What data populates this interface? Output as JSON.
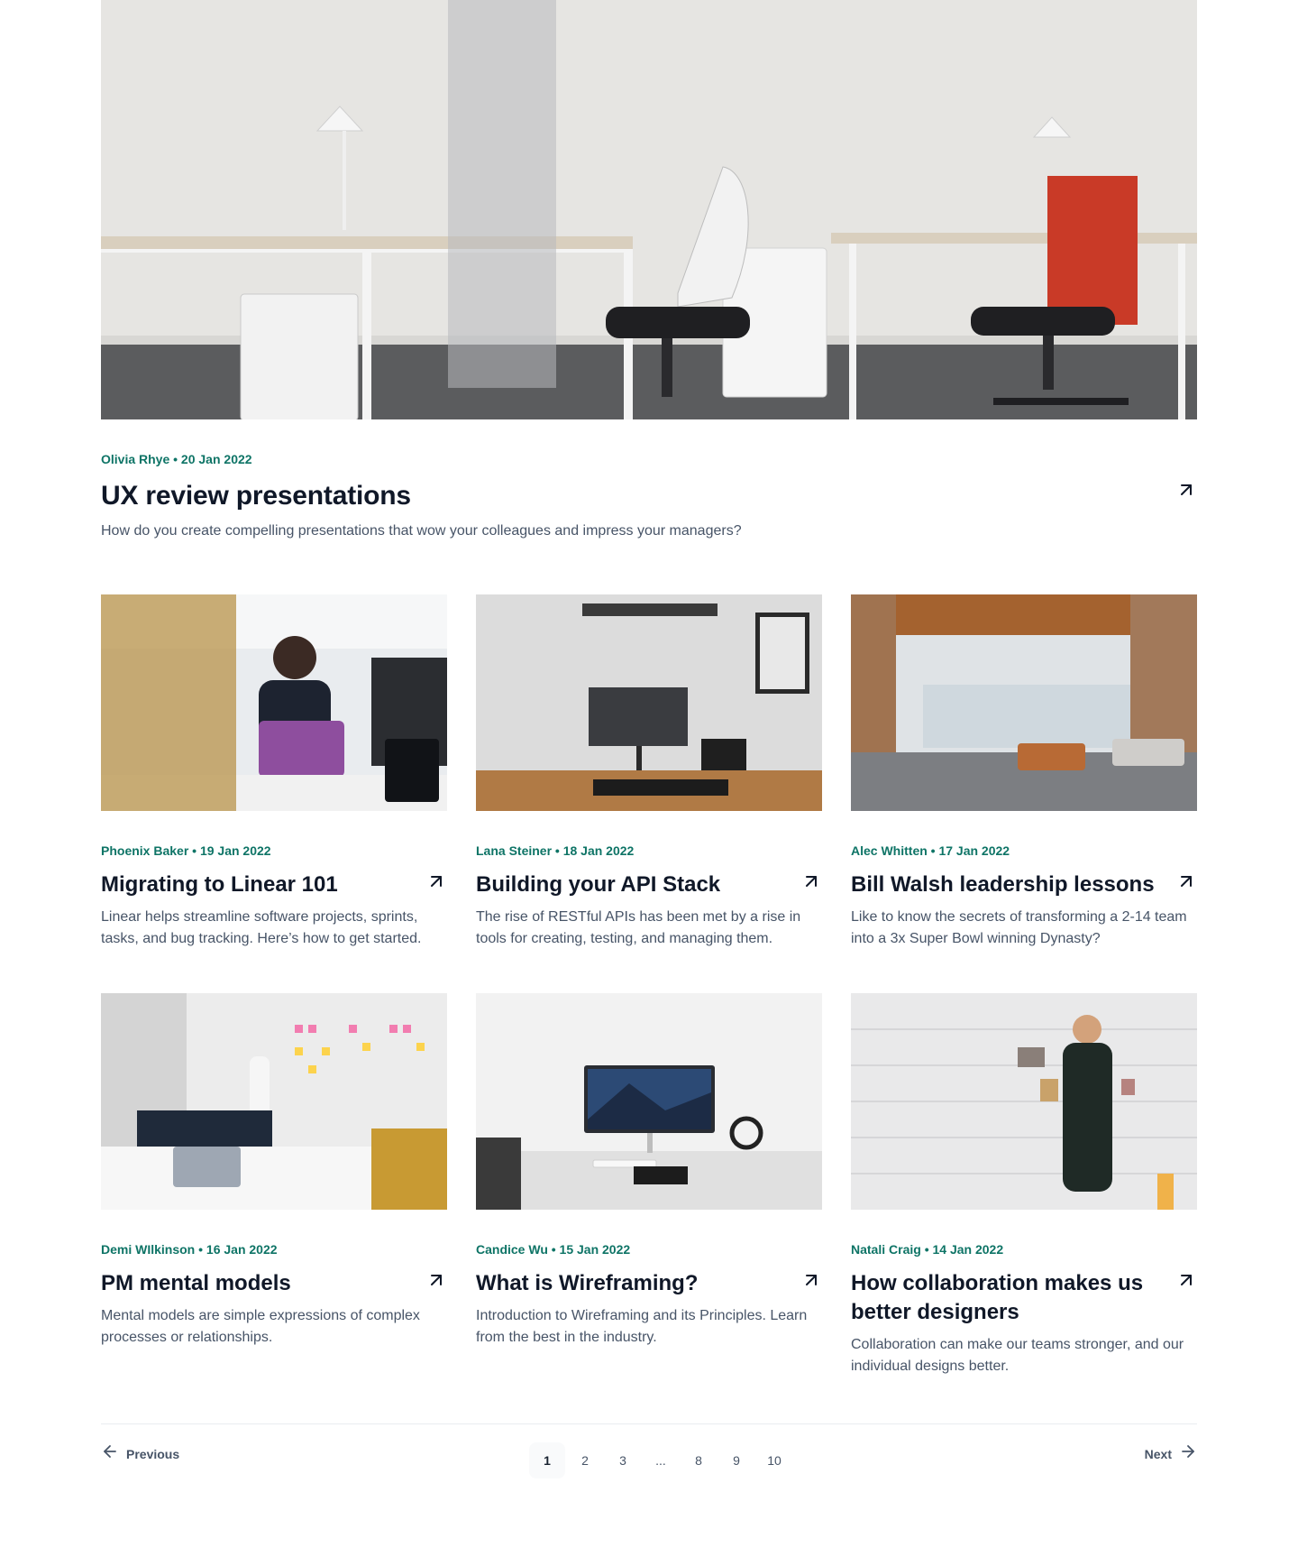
{
  "featured": {
    "meta": "Olivia Rhye • 20 Jan 2022",
    "title": "UX review presentations",
    "description": "How do you create compelling presentations that wow your colleagues and impress your managers?",
    "image": "office-desks-chairs-photo"
  },
  "posts": [
    {
      "meta": "Phoenix Baker • 19 Jan 2022",
      "title": "Migrating to Linear 101",
      "description": "Linear helps streamline software projects, sprints, tasks, and bug tracking. Here’s how to get started.",
      "image": "team-meeting-laptop-photo"
    },
    {
      "meta": "Lana Steiner • 18 Jan 2022",
      "title": "Building your API Stack",
      "description": "The rise of RESTful APIs has been met by a rise in tools for creating, testing, and managing them.",
      "image": "desk-monitor-setup-photo"
    },
    {
      "meta": "Alec Whitten • 17 Jan 2022",
      "title": "Bill Walsh leadership lessons",
      "description": "Like to know the secrets of transforming a 2-14 team into a 3x Super Bowl winning Dynasty?",
      "image": "open-office-photo"
    },
    {
      "meta": "Demi WIlkinson • 16 Jan 2022",
      "title": "PM mental models",
      "description": "Mental models are simple expressions of complex processes or relationships.",
      "image": "sticky-notes-workshop-photo"
    },
    {
      "meta": "Candice Wu • 15 Jan 2022",
      "title": "What is Wireframing?",
      "description": "Introduction to Wireframing and its Principles. Learn from the best in the industry.",
      "image": "white-desk-monitor-photo"
    },
    {
      "meta": "Natali Craig • 14 Jan 2022",
      "title": "How collaboration makes us better designers",
      "description": "Collaboration can make our teams stronger, and our individual designs better.",
      "image": "man-wall-photos-photo"
    }
  ],
  "pagination": {
    "previous_label": "Previous",
    "next_label": "Next",
    "pages": [
      "1",
      "2",
      "3",
      "...",
      "8",
      "9",
      "10"
    ],
    "current": "1"
  },
  "icons": {
    "card_arrow": "arrow-up-right-icon",
    "prev_arrow": "arrow-left-icon",
    "next_arrow": "arrow-right-icon"
  },
  "colors": {
    "accent": "#0e7466",
    "heading": "#101828",
    "body": "#475467",
    "divider": "#eaecf0"
  }
}
